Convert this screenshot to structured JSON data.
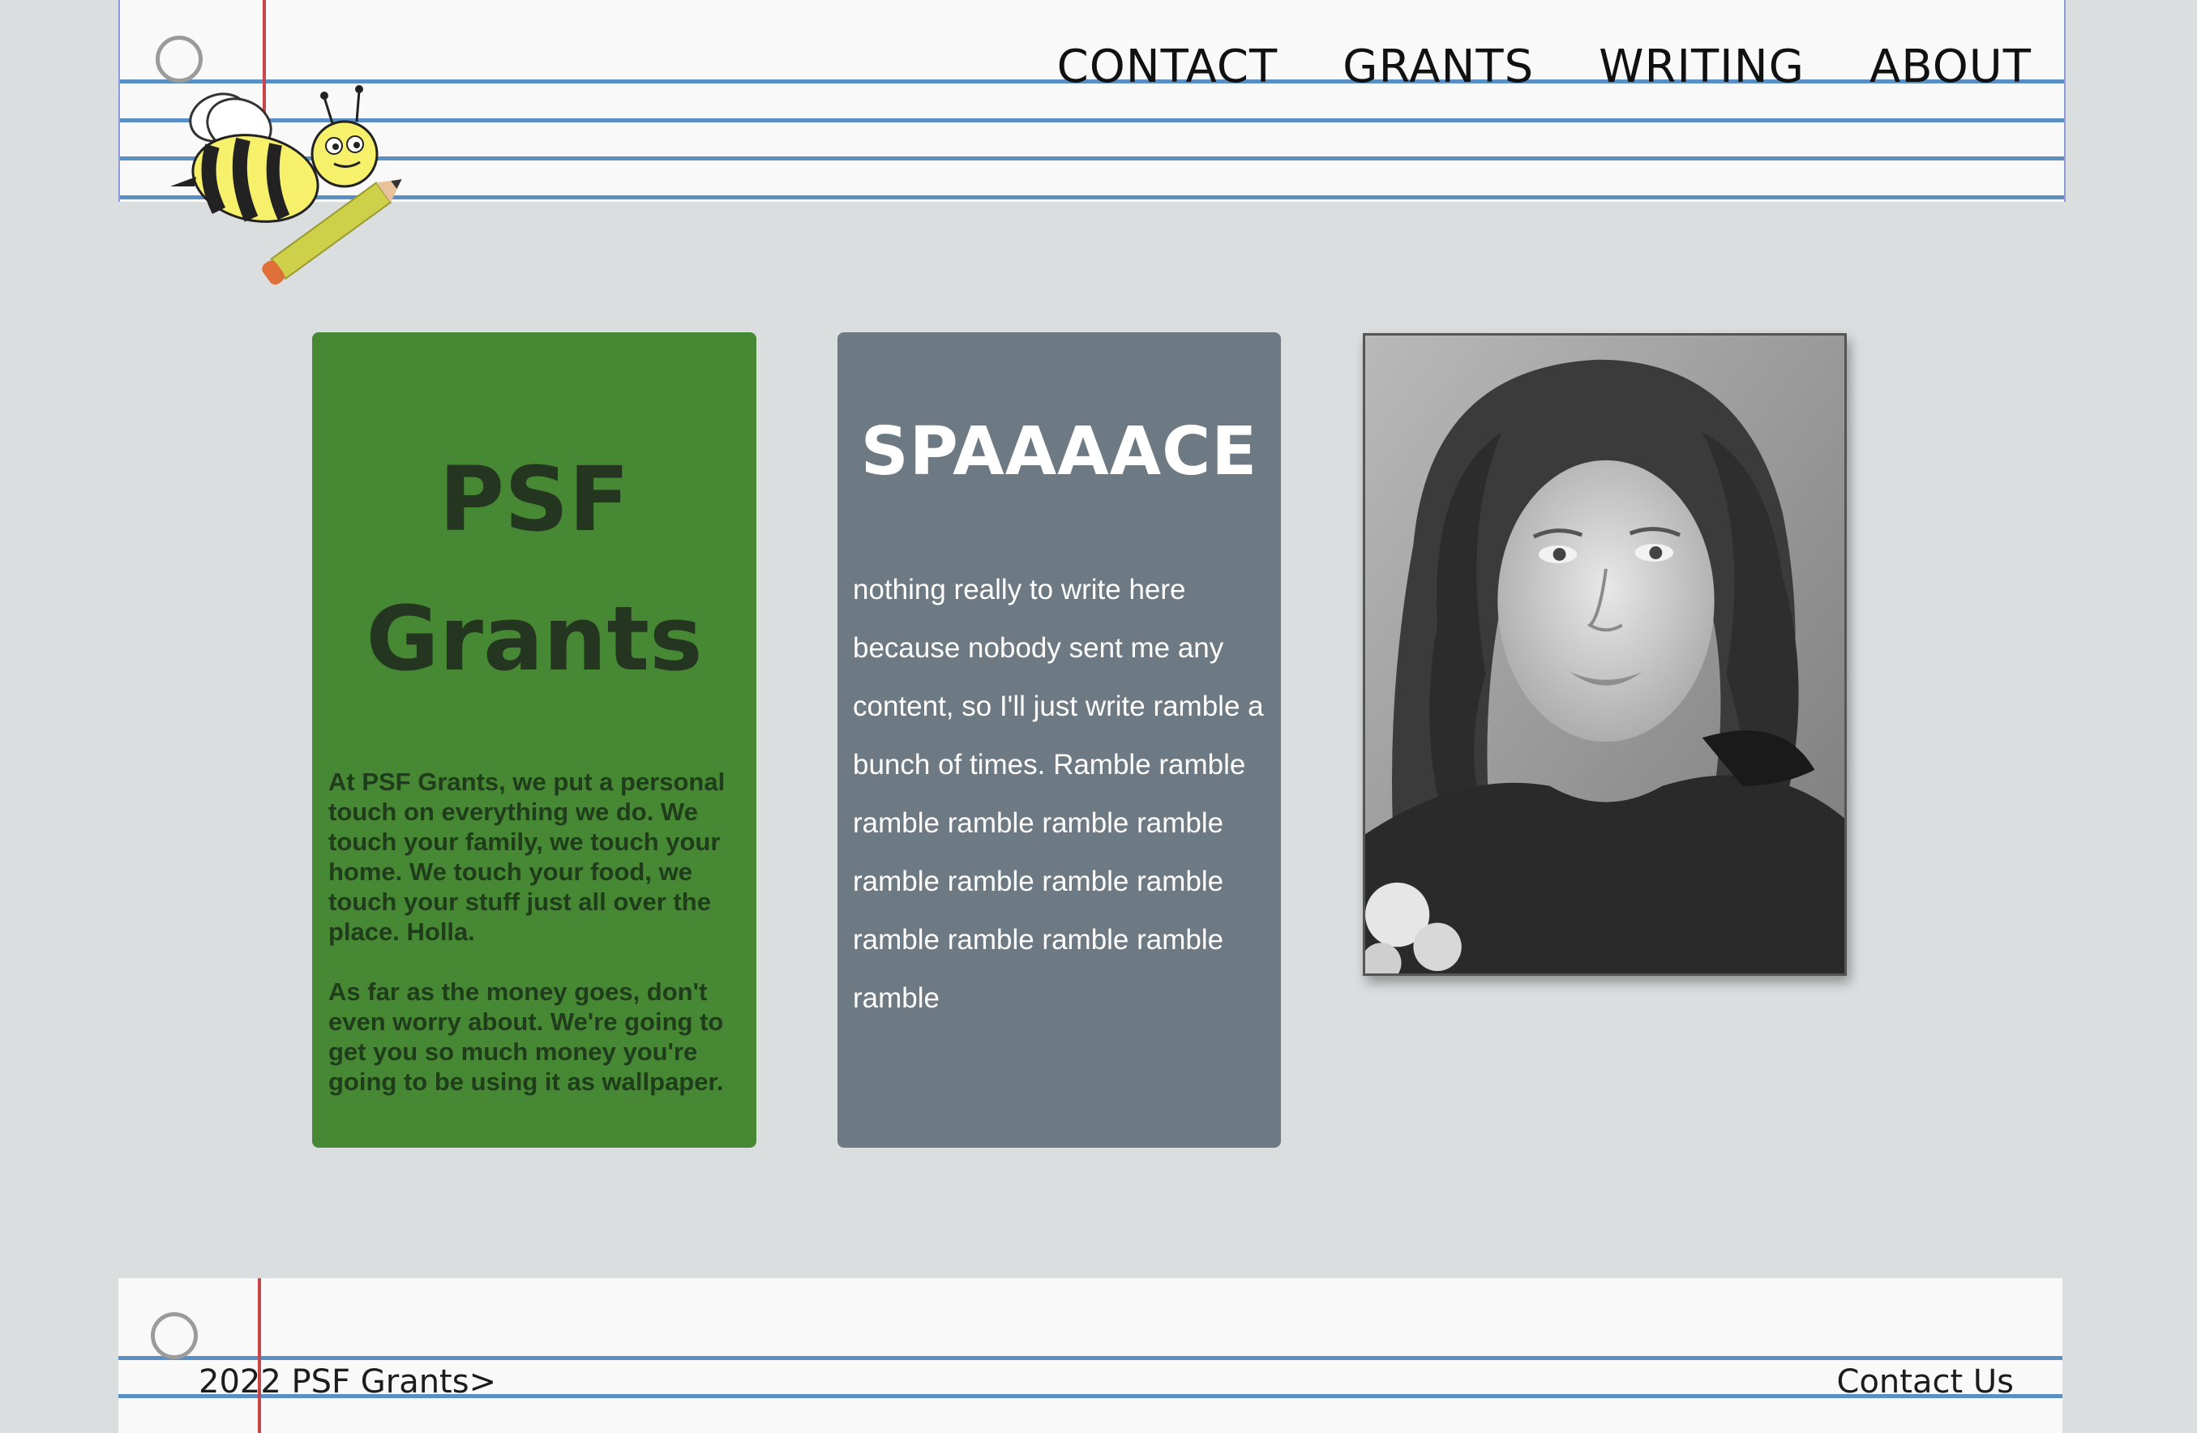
{
  "nav": {
    "items": [
      {
        "label": "CONTACT"
      },
      {
        "label": "GRANTS"
      },
      {
        "label": "WRITING"
      },
      {
        "label": "ABOUT"
      }
    ]
  },
  "cards": {
    "psf": {
      "title_line1": "PSF",
      "title_line2": "Grants",
      "paragraph1": "At PSF Grants, we put a personal touch on everything we do. We touch your family, we touch your home. We touch your food, we touch your stuff just all over the place. Holla.",
      "paragraph2": "As far as the money goes, don't even worry about. We're going to get you so much money you're going to be using it as wallpaper.",
      "background": "#468833"
    },
    "space": {
      "title": "SPAAAACE",
      "body": "nothing really to write here because nobody sent me any content, so I'll just write ramble a bunch of times. Ramble ramble ramble ramble ramble ramble ramble ramble ramble ramble ramble ramble ramble ramble ramble",
      "background": "#6e7a83"
    }
  },
  "photo": {
    "icon": "portrait-photo"
  },
  "footer": {
    "left_text": "2022 PSF Grants>",
    "right_link": "Contact Us"
  },
  "colors": {
    "page_bg": "#dbdedf",
    "paper": "#f8f9f8",
    "rule_blue": "#5a8fc6",
    "margin_red": "#c8464b"
  }
}
